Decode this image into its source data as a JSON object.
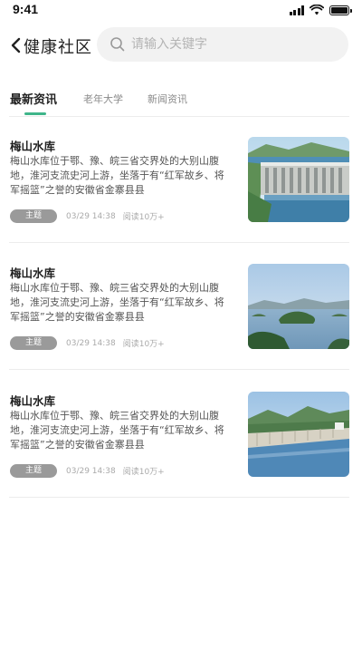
{
  "status_bar": {
    "time": "9:41"
  },
  "header": {
    "back_icon": "chevron-left-icon",
    "title": "健康社区",
    "search_placeholder": "请输入关键字"
  },
  "tabs": [
    {
      "label": "最新资讯",
      "active": true
    },
    {
      "label": "老年大学",
      "active": false
    },
    {
      "label": "新闻资讯",
      "active": false
    }
  ],
  "colors": {
    "accent": "#3fb58a",
    "tag_bg": "#9a9a9a"
  },
  "articles": [
    {
      "title": "梅山水库",
      "excerpt": "梅山水库位于鄂、豫、皖三省交界处的大别山腹地，淮河支流史河上游，坐落于有“红军故乡、将军摇篮”之誉的安徽省金寨县县",
      "tag": "主题",
      "date": "03/29 14:38",
      "reads": "阅读10万+",
      "image": "dam-photo"
    },
    {
      "title": "梅山水库",
      "excerpt": "梅山水库位于鄂、豫、皖三省交界处的大别山腹地，淮河支流史河上游，坐落于有“红军故乡、将军摇篮”之誉的安徽省金寨县县",
      "tag": "主题",
      "date": "03/29 14:38",
      "reads": "阅读10万+",
      "image": "lake-island-photo"
    },
    {
      "title": "梅山水库",
      "excerpt": "梅山水库位于鄂、豫、皖三省交界处的大别山腹地，淮河支流史河上游，坐落于有“红军故乡、将军摇篮”之誉的安徽省金寨县县",
      "tag": "主题",
      "date": "03/29 14:38",
      "reads": "阅读10万+",
      "image": "dam-wall-photo"
    }
  ]
}
